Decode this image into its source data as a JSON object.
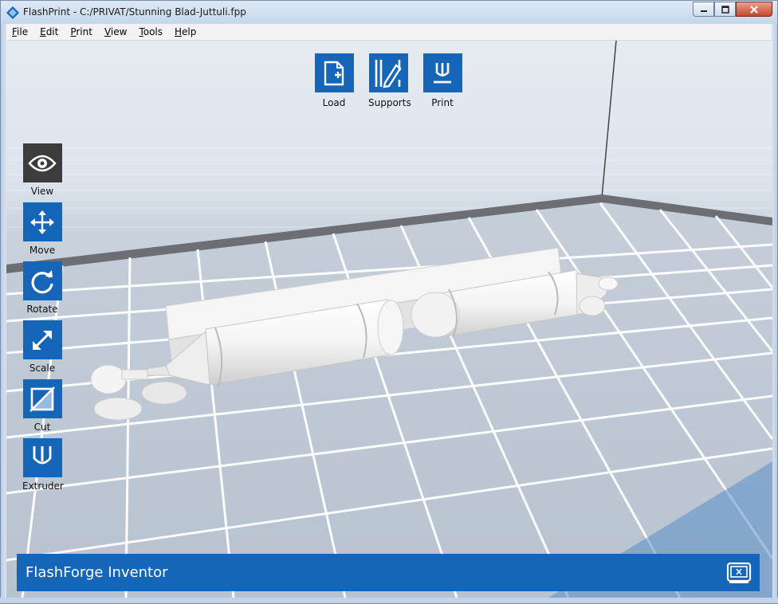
{
  "window": {
    "title": "FlashPrint - C:/PRIVAT/Stunning Blad-Juttuli.fpp",
    "icons": {
      "app": "flashprint-logo-icon",
      "minimize": "minimize-icon",
      "maximize": "maximize-icon",
      "close": "close-icon"
    }
  },
  "menu": {
    "items": [
      "File",
      "Edit",
      "Print",
      "View",
      "Tools",
      "Help"
    ]
  },
  "top_toolbar": {
    "load": {
      "label": "Load",
      "icon": "load-file-icon"
    },
    "supports": {
      "label": "Supports",
      "icon": "supports-icon"
    },
    "print": {
      "label": "Print",
      "icon": "print-icon"
    }
  },
  "left_toolbar": {
    "view": {
      "label": "View",
      "icon": "eye-icon",
      "active": true
    },
    "move": {
      "label": "Move",
      "icon": "move-arrows-icon"
    },
    "rotate": {
      "label": "Rotate",
      "icon": "rotate-icon"
    },
    "scale": {
      "label": "Scale",
      "icon": "scale-icon"
    },
    "cut": {
      "label": "Cut",
      "icon": "cut-icon"
    },
    "extruder": {
      "label": "Extruder",
      "icon": "extruder-icon"
    }
  },
  "printer_bar": {
    "name": "FlashForge Inventor",
    "icon": "printer-status-icon"
  },
  "colors": {
    "accent": "#1565b8",
    "active_tool": "#3c3c3c",
    "grid_floor": "#c3ccd7",
    "grid_line": "#ffffff",
    "model": "#f4f4f4"
  }
}
